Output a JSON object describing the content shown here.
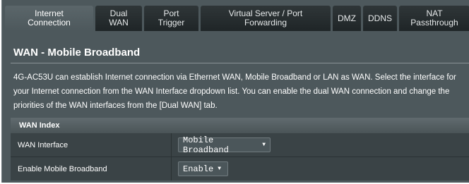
{
  "tabs": [
    {
      "label": "Internet\nConnection",
      "active": true
    },
    {
      "label": "Dual\nWAN",
      "active": false
    },
    {
      "label": "Port\nTrigger",
      "active": false
    },
    {
      "label": "Virtual Server / Port\nForwarding",
      "active": false
    },
    {
      "label": "DMZ",
      "active": false
    },
    {
      "label": "DDNS",
      "active": false
    },
    {
      "label": "NAT\nPassthrough",
      "active": false
    }
  ],
  "page": {
    "title": "WAN - Mobile Broadband",
    "description": "4G-AC53U can establish Internet connection via Ethernet WAN, Mobile Broadband or LAN as WAN. Select the interface for your Internet connection from the WAN Interface dropdown list. You can enable the dual WAN connection and change the priorities of the WAN interfaces from the [Dual WAN] tab."
  },
  "wan_index": {
    "header": "WAN Index",
    "rows": [
      {
        "label": "WAN Interface",
        "value": "Mobile Broadband"
      },
      {
        "label": "Enable Mobile Broadband",
        "value": "Enable"
      }
    ]
  },
  "colors": {
    "panel_bg": "#4d585c",
    "tab_bg": "#1f2527",
    "row_bg": "#3a4346"
  }
}
